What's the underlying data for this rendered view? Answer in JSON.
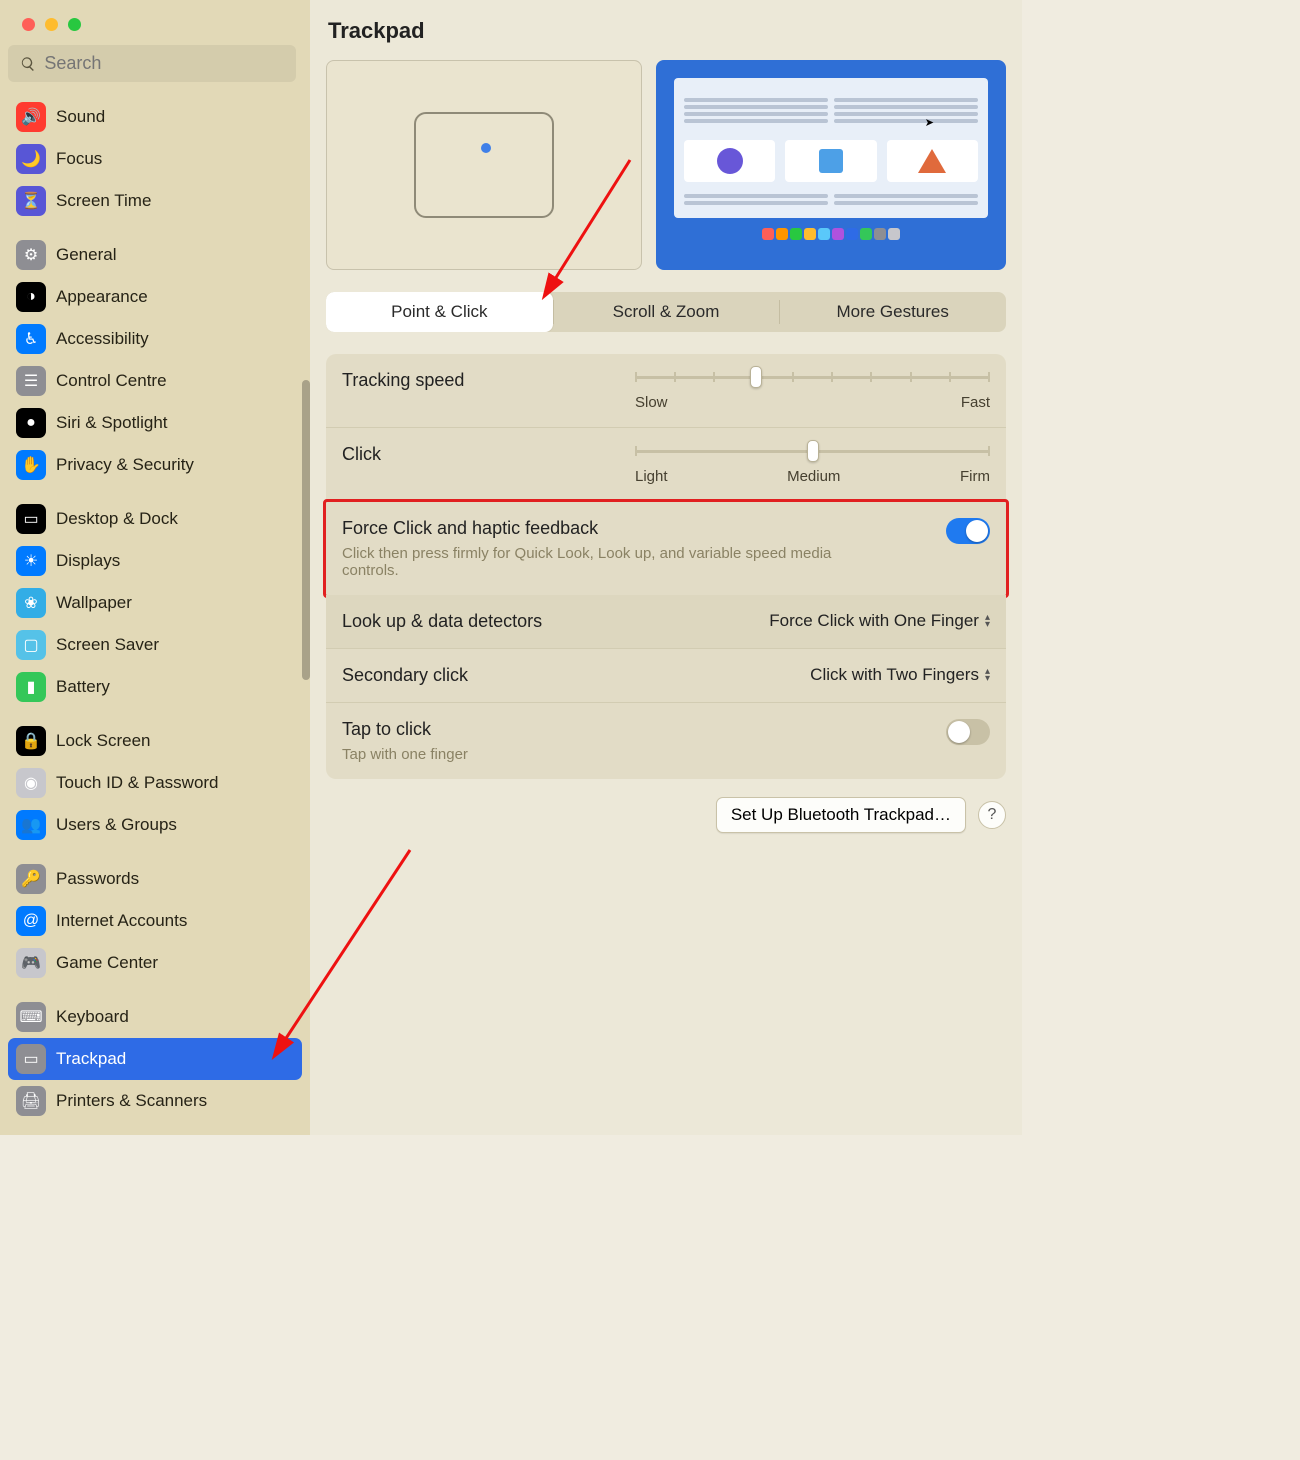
{
  "title": "Trackpad",
  "search_placeholder": "Search",
  "sidebar_groups": [
    [
      {
        "id": "sound",
        "label": "Sound",
        "color": "bg-red",
        "glyph": "🔊"
      },
      {
        "id": "focus",
        "label": "Focus",
        "color": "bg-indigo",
        "glyph": "🌙"
      },
      {
        "id": "screen-time",
        "label": "Screen Time",
        "color": "bg-indigo",
        "glyph": "⏳"
      }
    ],
    [
      {
        "id": "general",
        "label": "General",
        "color": "bg-gray",
        "glyph": "⚙︎"
      },
      {
        "id": "appearance",
        "label": "Appearance",
        "color": "bg-black",
        "glyph": "◑"
      },
      {
        "id": "accessibility",
        "label": "Accessibility",
        "color": "bg-blue",
        "glyph": "♿︎"
      },
      {
        "id": "control-centre",
        "label": "Control Centre",
        "color": "bg-gray",
        "glyph": "☰"
      },
      {
        "id": "siri",
        "label": "Siri & Spotlight",
        "color": "bg-black",
        "glyph": "●"
      },
      {
        "id": "privacy",
        "label": "Privacy & Security",
        "color": "bg-blue",
        "glyph": "✋"
      }
    ],
    [
      {
        "id": "desktop-dock",
        "label": "Desktop & Dock",
        "color": "bg-black",
        "glyph": "▭"
      },
      {
        "id": "displays",
        "label": "Displays",
        "color": "bg-blue",
        "glyph": "☀︎"
      },
      {
        "id": "wallpaper",
        "label": "Wallpaper",
        "color": "bg-teal",
        "glyph": "❀"
      },
      {
        "id": "screen-saver",
        "label": "Screen Saver",
        "color": "bg-cyan",
        "glyph": "▢"
      },
      {
        "id": "battery",
        "label": "Battery",
        "color": "bg-green",
        "glyph": "▮"
      }
    ],
    [
      {
        "id": "lock-screen",
        "label": "Lock Screen",
        "color": "bg-black",
        "glyph": "🔒"
      },
      {
        "id": "touch-id",
        "label": "Touch ID & Password",
        "color": "bg-lightgray",
        "glyph": "◉"
      },
      {
        "id": "users-groups",
        "label": "Users & Groups",
        "color": "bg-blue",
        "glyph": "👥"
      }
    ],
    [
      {
        "id": "passwords",
        "label": "Passwords",
        "color": "bg-gray",
        "glyph": "🔑"
      },
      {
        "id": "internet-accounts",
        "label": "Internet Accounts",
        "color": "bg-blue",
        "glyph": "@"
      },
      {
        "id": "game-center",
        "label": "Game Center",
        "color": "bg-lightgray",
        "glyph": "🎮"
      }
    ],
    [
      {
        "id": "keyboard",
        "label": "Keyboard",
        "color": "bg-gray",
        "glyph": "⌨︎"
      },
      {
        "id": "trackpad",
        "label": "Trackpad",
        "color": "bg-gray",
        "glyph": "▭",
        "selected": true
      },
      {
        "id": "printers",
        "label": "Printers & Scanners",
        "color": "bg-gray",
        "glyph": "🖨"
      }
    ]
  ],
  "tabs": {
    "point_click": "Point & Click",
    "scroll_zoom": "Scroll & Zoom",
    "more_gestures": "More Gestures"
  },
  "tracking": {
    "label": "Tracking speed",
    "slow": "Slow",
    "fast": "Fast",
    "pos_pct": 34
  },
  "click": {
    "label": "Click",
    "light": "Light",
    "medium": "Medium",
    "firm": "Firm",
    "pos_pct": 50
  },
  "force_click": {
    "label": "Force Click and haptic feedback",
    "desc": "Click then press firmly for Quick Look, Look up, and variable speed media controls.",
    "on": true
  },
  "lookup": {
    "label": "Look up & data detectors",
    "value": "Force Click with One Finger"
  },
  "secondary": {
    "label": "Secondary click",
    "value": "Click with Two Fingers"
  },
  "tap": {
    "label": "Tap to click",
    "desc": "Tap with one finger",
    "on": false
  },
  "setup_bt": "Set Up Bluetooth Trackpad…",
  "help": "?",
  "dock_colors": [
    "#ff5f57",
    "#ff9500",
    "#28c840",
    "#febc2e",
    "#5ac8fa",
    "#af52de",
    "#2e6be6",
    "#34c759",
    "#8e8e93",
    "#c7c7cc"
  ]
}
